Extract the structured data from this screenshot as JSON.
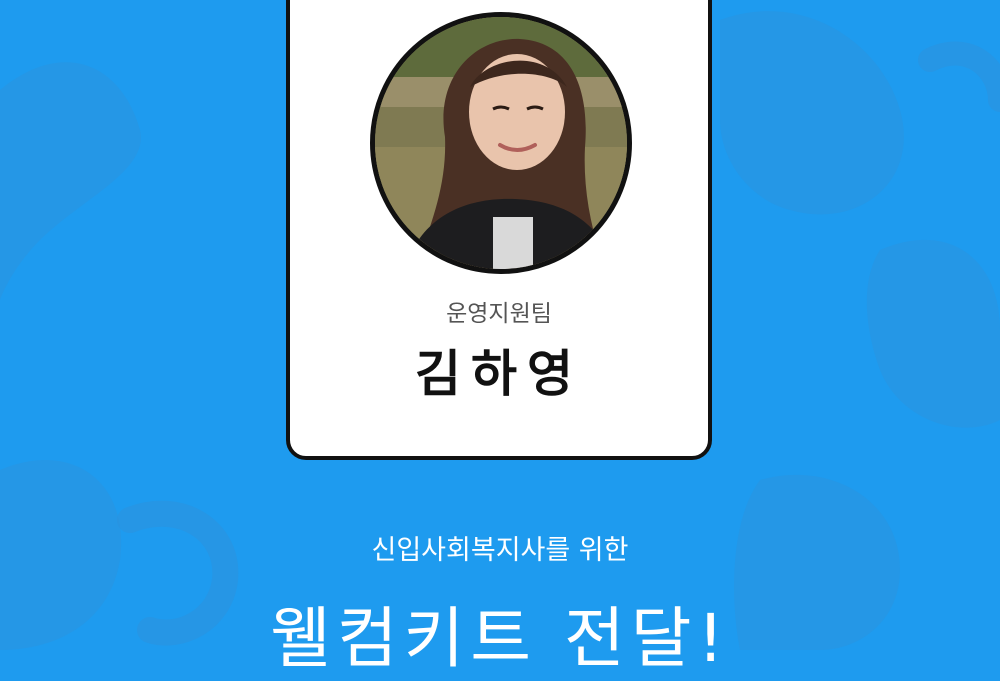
{
  "profile": {
    "team": "운영지원팀",
    "name": "김하영",
    "photo_icon": "person-photo"
  },
  "banner": {
    "subtitle": "신입사회복지사를 위한",
    "headline": "웰컴키트 전달!"
  },
  "colors": {
    "background": "#1e9bef",
    "decoration": "#2b8fd8",
    "card": "#ffffff",
    "border": "#111111"
  }
}
